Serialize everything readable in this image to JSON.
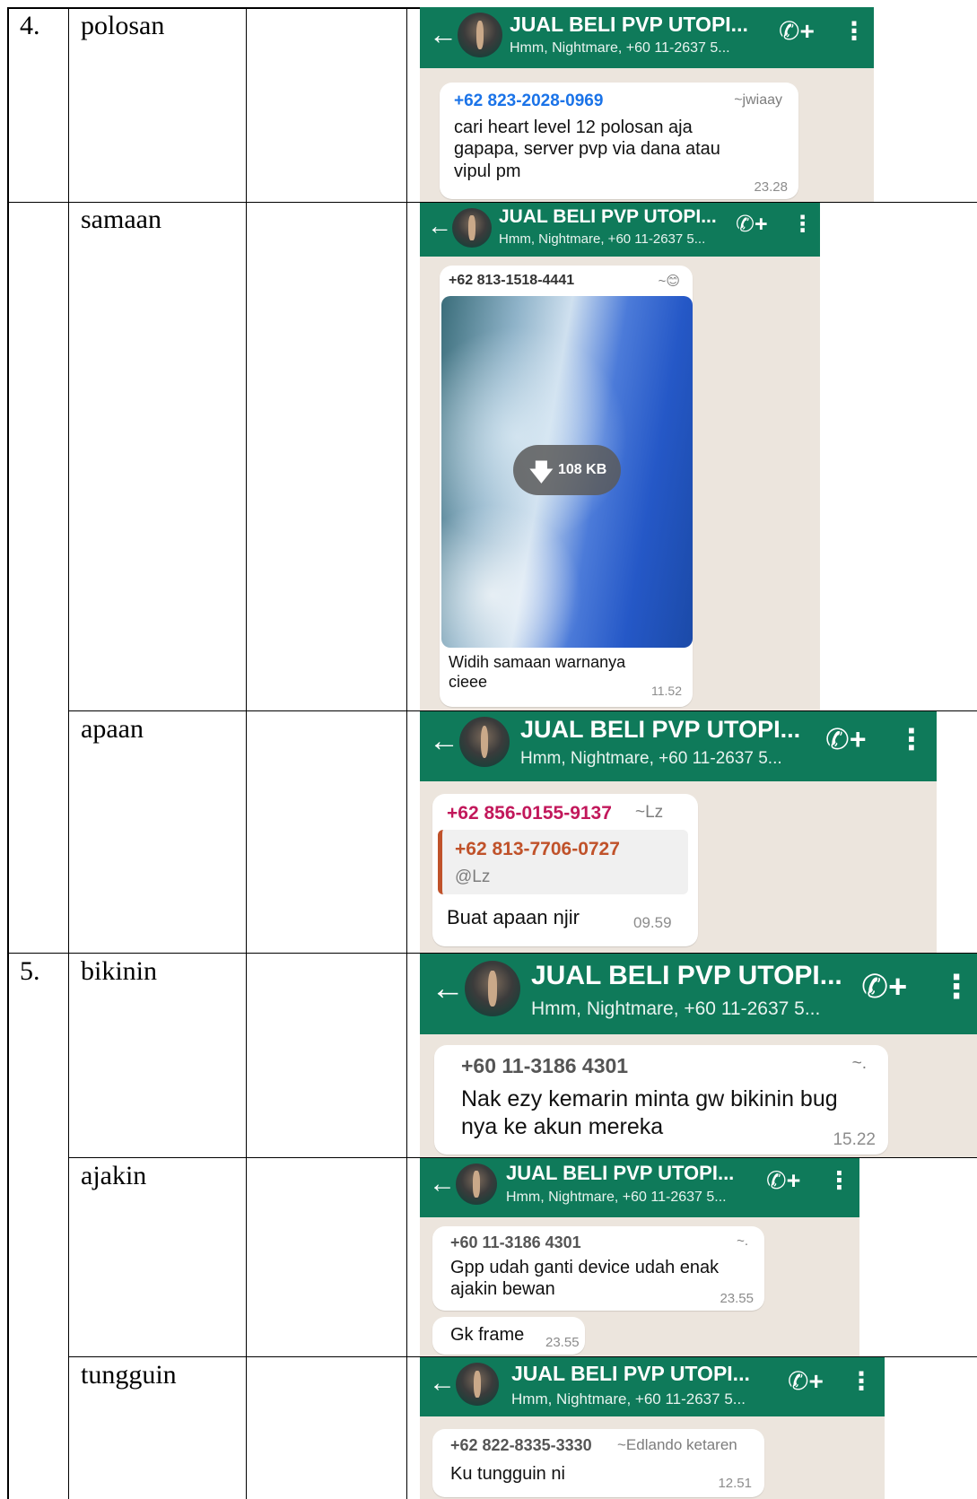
{
  "table": {
    "rows": [
      {
        "number": "4.",
        "word": "polosan"
      },
      {
        "number": "",
        "word": "samaan"
      },
      {
        "number": "",
        "word": "apaan"
      },
      {
        "number": "5.",
        "word": "bikinin"
      },
      {
        "number": "",
        "word": "ajakin"
      },
      {
        "number": "",
        "word": "tungguin"
      }
    ]
  },
  "chat_header": {
    "group_title": "JUAL BELI PVP UTOPI...",
    "members": "Hmm, Nightmare, +60 11-2637 5...",
    "back_icon": "arrow-left-icon",
    "call_icon": "add-call-icon",
    "menu_icon": "more-vert-icon"
  },
  "shots": [
    {
      "sender": "+62 823-2028-0969",
      "sender_color": "#1a73e8",
      "alias": "~jwiaay",
      "text": "cari heart level 12 polosan aja gapapa, server pvp via dana atau vipul pm",
      "time": "23.28"
    },
    {
      "sender": "+62 813-1518-4441",
      "sender_color": "#333333",
      "alias": "~😊",
      "download_size": "108 KB",
      "text": "Widih samaan warnanya cieee",
      "time": "11.52"
    },
    {
      "sender": "+62 856-0155-9137",
      "sender_color": "#c2185b",
      "alias": "~Lz",
      "quote_sender": "+62 813-7706-0727",
      "quote_sender_color": "#c0522a",
      "quote_text": "@Lz",
      "text": "Buat apaan njir",
      "time": "09.59"
    },
    {
      "sender": "+60 11-3186 4301",
      "sender_color": "#555555",
      "alias": "~.",
      "text": "Nak ezy kemarin minta gw bikinin bug nya ke akun mereka",
      "time": "15.22"
    },
    {
      "sender": "+60 11-3186 4301",
      "sender_color": "#555555",
      "alias": "~.",
      "text": "Gpp udah ganti device udah enak ajakin bewan",
      "time": "23.55",
      "second_text": "Gk frame",
      "second_time": "23.55"
    },
    {
      "sender": "+62 822-8335-3330",
      "sender_color": "#555555",
      "alias": "~Edlando ketaren",
      "text": "Ku tungguin ni",
      "time": "12.51"
    }
  ],
  "colors": {
    "header_green": "#0f7a5a",
    "chat_bg": "#ece5dd"
  }
}
